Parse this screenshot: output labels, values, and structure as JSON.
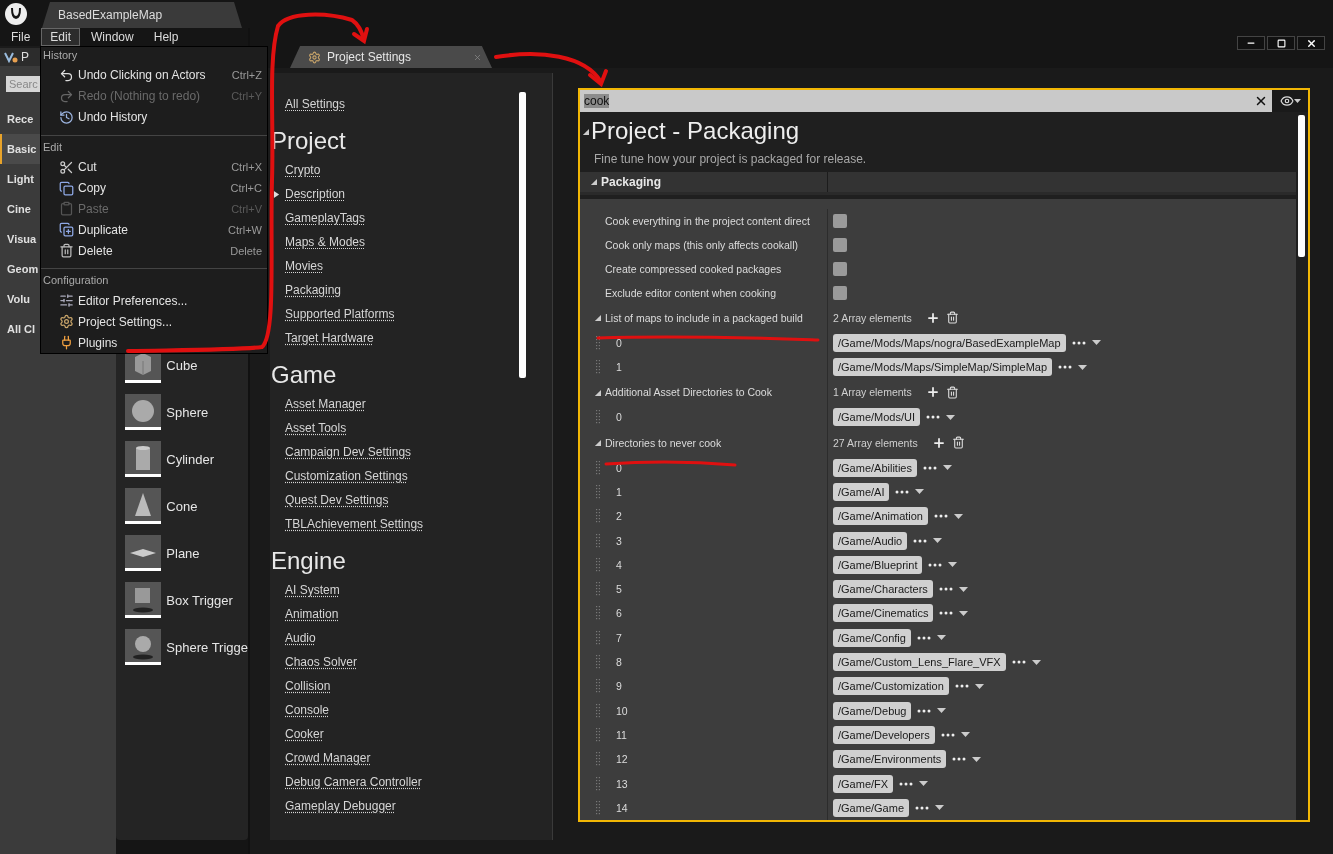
{
  "app_tab": "BasedExampleMap",
  "menu_bar": [
    {
      "label": "File",
      "selected": false
    },
    {
      "label": "Edit",
      "selected": true
    },
    {
      "label": "Window",
      "selected": false
    },
    {
      "label": "Help",
      "selected": false
    }
  ],
  "edit_menu": [
    {
      "heading": "History",
      "items": [
        {
          "kind": "undo",
          "label": "Undo Clicking on Actors",
          "shortcut": "Ctrl+Z",
          "disabled": false
        },
        {
          "kind": "redo",
          "label": "Redo (Nothing to redo)",
          "shortcut": "Ctrl+Y",
          "disabled": true
        },
        {
          "kind": "history",
          "label": "Undo History",
          "disabled": false
        }
      ]
    },
    {
      "heading": "Edit",
      "items": [
        {
          "kind": "cut",
          "label": "Cut",
          "shortcut": "Ctrl+X",
          "disabled": false
        },
        {
          "kind": "copy",
          "label": "Copy",
          "shortcut": "Ctrl+C",
          "disabled": false
        },
        {
          "kind": "paste",
          "label": "Paste",
          "shortcut": "Ctrl+V",
          "disabled": true
        },
        {
          "kind": "duplicate",
          "label": "Duplicate",
          "shortcut": "Ctrl+W",
          "disabled": false
        },
        {
          "kind": "delete",
          "label": "Delete",
          "shortcut": "Delete",
          "disabled": false
        }
      ]
    },
    {
      "heading": "Configuration",
      "items": [
        {
          "kind": "preferences",
          "label": "Editor Preferences...",
          "disabled": false
        },
        {
          "kind": "settings",
          "label": "Project Settings...",
          "disabled": false
        },
        {
          "kind": "plugins",
          "label": "Plugins",
          "disabled": false
        }
      ]
    }
  ],
  "place_actors": {
    "tab": "P",
    "search": {
      "placeholder": "Searc"
    },
    "categories": [
      {
        "label": "Rece",
        "selected": false
      },
      {
        "label": "Basic",
        "selected": true
      },
      {
        "label": "Light",
        "selected": false
      },
      {
        "label": "Cine",
        "selected": false
      },
      {
        "label": "Visua",
        "selected": false
      },
      {
        "label": "Geom",
        "selected": false
      },
      {
        "label": "Volu",
        "selected": false
      },
      {
        "label": "All Cl",
        "selected": false
      }
    ],
    "items": [
      {
        "kind": "cube",
        "label": "Cube"
      },
      {
        "kind": "sphere",
        "label": "Sphere"
      },
      {
        "kind": "cylinder",
        "label": "Cylinder"
      },
      {
        "kind": "cone",
        "label": "Cone"
      },
      {
        "kind": "plane",
        "label": "Plane"
      },
      {
        "kind": "box_trigger",
        "label": "Box Trigger"
      },
      {
        "kind": "sphere_trigger",
        "label": "Sphere Trigge"
      }
    ]
  },
  "project_settings": {
    "tab": "Project Settings",
    "nav": {
      "top": "All Settings",
      "groups": [
        {
          "title": "Project",
          "items": [
            {
              "label": "Crypto",
              "expandable": false
            },
            {
              "label": "Description",
              "expandable": true
            },
            {
              "label": "GameplayTags",
              "expandable": false
            },
            {
              "label": "Maps & Modes",
              "expandable": false
            },
            {
              "label": "Movies",
              "expandable": false
            },
            {
              "label": "Packaging",
              "expandable": false
            },
            {
              "label": "Supported Platforms",
              "expandable": false
            },
            {
              "label": "Target Hardware",
              "expandable": false
            }
          ]
        },
        {
          "title": "Game",
          "items": [
            {
              "label": "Asset Manager",
              "expandable": false
            },
            {
              "label": "Asset Tools",
              "expandable": false
            },
            {
              "label": "Campaign Dev Settings",
              "expandable": false
            },
            {
              "label": "Customization Settings",
              "expandable": false
            },
            {
              "label": "Quest Dev Settings",
              "expandable": false
            },
            {
              "label": "TBLAchievement Settings",
              "expandable": false
            }
          ]
        },
        {
          "title": "Engine",
          "items": [
            {
              "label": "AI System",
              "expandable": false
            },
            {
              "label": "Animation",
              "expandable": false
            },
            {
              "label": "Audio",
              "expandable": false
            },
            {
              "label": "Chaos Solver",
              "expandable": false
            },
            {
              "label": "Collision",
              "expandable": false
            },
            {
              "label": "Console",
              "expandable": false
            },
            {
              "label": "Cooker",
              "expandable": false
            },
            {
              "label": "Crowd Manager",
              "expandable": false
            },
            {
              "label": "Debug Camera Controller",
              "expandable": false
            },
            {
              "label": "Gameplay Debugger",
              "expandable": false
            }
          ]
        }
      ]
    },
    "details": {
      "search": {
        "value": "cook"
      },
      "title": "Project - Packaging",
      "subtitle": "Fine tune how your project is packaged for release.",
      "category": {
        "label": "Packaging",
        "expanded": true
      },
      "rows": [
        {
          "kind": "checkbox",
          "label": "Cook everything in the project content direct",
          "checked": false
        },
        {
          "kind": "checkbox",
          "label": "Cook only maps (this only affects cookall)",
          "checked": false
        },
        {
          "kind": "checkbox",
          "label": "Create compressed cooked packages",
          "checked": false
        },
        {
          "kind": "checkbox",
          "label": "Exclude editor content when cooking",
          "checked": false
        },
        {
          "kind": "array",
          "label": "List of maps to include in a packaged build",
          "count": "2 Array elements",
          "expanded": true
        },
        {
          "kind": "element",
          "index": "0",
          "value": "/Game/Mods/Maps/nogra/BasedExampleMap"
        },
        {
          "kind": "element",
          "index": "1",
          "value": "/Game/Mods/Maps/SimpleMap/SimpleMap"
        },
        {
          "kind": "array",
          "label": "Additional Asset Directories to Cook",
          "count": "1 Array elements",
          "expanded": true
        },
        {
          "kind": "element",
          "index": "0",
          "value": "/Game/Mods/UI"
        },
        {
          "kind": "array",
          "label": "Directories to never cook",
          "count": "27 Array elements",
          "expanded": true
        },
        {
          "kind": "element",
          "index": "0",
          "value": "/Game/Abilities"
        },
        {
          "kind": "element",
          "index": "1",
          "value": "/Game/AI"
        },
        {
          "kind": "element",
          "index": "2",
          "value": "/Game/Animation"
        },
        {
          "kind": "element",
          "index": "3",
          "value": "/Game/Audio"
        },
        {
          "kind": "element",
          "index": "4",
          "value": "/Game/Blueprint"
        },
        {
          "kind": "element",
          "index": "5",
          "value": "/Game/Characters"
        },
        {
          "kind": "element",
          "index": "6",
          "value": "/Game/Cinematics"
        },
        {
          "kind": "element",
          "index": "7",
          "value": "/Game/Config"
        },
        {
          "kind": "element",
          "index": "8",
          "value": "/Game/Custom_Lens_Flare_VFX"
        },
        {
          "kind": "element",
          "index": "9",
          "value": "/Game/Customization"
        },
        {
          "kind": "element",
          "index": "10",
          "value": "/Game/Debug"
        },
        {
          "kind": "element",
          "index": "11",
          "value": "/Game/Developers"
        },
        {
          "kind": "element",
          "index": "12",
          "value": "/Game/Environments"
        },
        {
          "kind": "element",
          "index": "13",
          "value": "/Game/FX"
        },
        {
          "kind": "element",
          "index": "14",
          "value": "/Game/Game"
        }
      ]
    }
  }
}
